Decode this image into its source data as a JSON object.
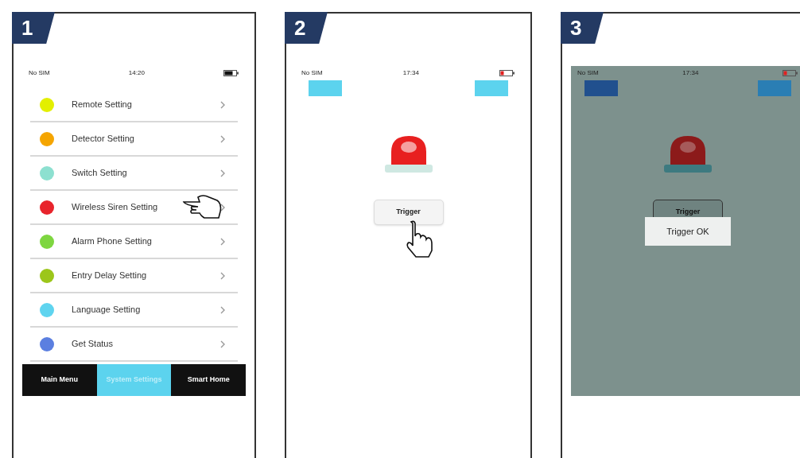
{
  "steps": [
    {
      "number": "1",
      "screen": {
        "kind": "menu",
        "status": {
          "carrier": "No SIM",
          "time": "14:20",
          "battery_low": false
        },
        "items": [
          {
            "label": "Remote Setting",
            "color": "#e3ef00",
            "pointer": false
          },
          {
            "label": "Detector Setting",
            "color": "#f5a500",
            "pointer": false
          },
          {
            "label": "Switch Setting",
            "color": "#8de0d0",
            "pointer": false
          },
          {
            "label": "Wireless Siren Setting",
            "color": "#e8242c",
            "pointer": true
          },
          {
            "label": "Alarm Phone Setting",
            "color": "#7ed640",
            "pointer": false
          },
          {
            "label": "Entry Delay Setting",
            "color": "#9cc61a",
            "pointer": false
          },
          {
            "label": "Language Setting",
            "color": "#5fd4ef",
            "pointer": false
          },
          {
            "label": "Get Status",
            "color": "#5b7fe0",
            "pointer": false
          }
        ],
        "tabs": [
          {
            "label": "Main Menu",
            "selected": false
          },
          {
            "label": "System Settings",
            "selected": true
          },
          {
            "label": "Smart Home",
            "selected": false
          }
        ]
      }
    },
    {
      "number": "2",
      "screen": {
        "kind": "siren",
        "dimmed": false,
        "status": {
          "carrier": "No SIM",
          "time": "17:34",
          "battery_low": true
        },
        "trigger": {
          "label": "Trigger",
          "pointer": true
        }
      }
    },
    {
      "number": "3",
      "screen": {
        "kind": "siren",
        "dimmed": true,
        "status": {
          "carrier": "No SIM",
          "time": "17:34",
          "battery_low": true
        },
        "trigger": {
          "label": "Trigger"
        },
        "toast": "Trigger OK"
      }
    }
  ]
}
